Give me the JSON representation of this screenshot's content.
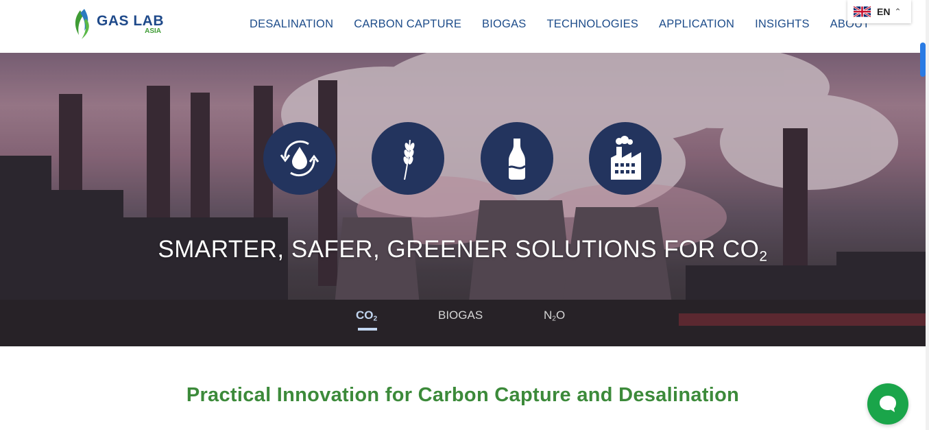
{
  "logo": {
    "word1": "GAS",
    "word2": "LAB",
    "sub": "ASIA"
  },
  "nav": {
    "items": [
      {
        "label": "DESALINATION"
      },
      {
        "label": "CARBON CAPTURE"
      },
      {
        "label": "BIOGAS"
      },
      {
        "label": "TECHNOLOGIES"
      },
      {
        "label": "APPLICATION"
      },
      {
        "label": "INSIGHTS"
      },
      {
        "label": "ABOUT"
      }
    ]
  },
  "language": {
    "code": "EN",
    "flag": "uk-flag-icon"
  },
  "hero": {
    "icons": [
      "water-cycle-icon",
      "wheat-icon",
      "bottle-icon",
      "factory-icon"
    ],
    "title_prefix": "SMARTER, SAFER, GREENER SOLUTIONS FOR CO",
    "title_subscript": "2",
    "tabs": [
      {
        "label": "CO",
        "sub": "2",
        "active": true
      },
      {
        "label": "BIOGAS",
        "sub": "",
        "active": false
      },
      {
        "label": "N",
        "sub": "2",
        "suffix": "O",
        "active": false
      }
    ]
  },
  "section": {
    "heading": "Practical Innovation for Carbon Capture and Desalination"
  },
  "chat": {
    "icon": "chat-bubble-icon"
  },
  "colors": {
    "brand_blue": "#1d4c8a",
    "brand_green": "#3c8a3a",
    "icon_circle": "#23345e",
    "chat_green": "#1aa54a"
  }
}
